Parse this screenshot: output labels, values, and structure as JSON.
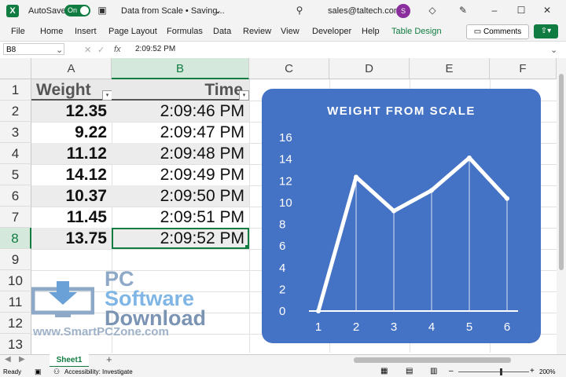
{
  "titlebar": {
    "autosave_label": "AutoSave",
    "autosave_state": "On",
    "doc_title": "Data from Scale • Saving...",
    "account": "sales@taltech.com",
    "avatar_initial": "S"
  },
  "ribbon": {
    "tabs": [
      "File",
      "Home",
      "Insert",
      "Page Layout",
      "Formulas",
      "Data",
      "Review",
      "View",
      "Developer",
      "Help",
      "Table Design"
    ],
    "comments_label": "Comments"
  },
  "formula_bar": {
    "name_box": "B8",
    "fx_label": "fx",
    "value": "2:09:52 PM"
  },
  "grid": {
    "columns": [
      "A",
      "B",
      "C",
      "D",
      "E",
      "F"
    ],
    "rows": [
      "1",
      "2",
      "3",
      "4",
      "5",
      "6",
      "7",
      "8",
      "9",
      "10",
      "11",
      "12",
      "13"
    ],
    "table": {
      "headers": [
        "Weight",
        "Time"
      ],
      "rows": [
        [
          "12.35",
          "2:09:46 PM"
        ],
        [
          "9.22",
          "2:09:47 PM"
        ],
        [
          "11.12",
          "2:09:48 PM"
        ],
        [
          "14.12",
          "2:09:49 PM"
        ],
        [
          "10.37",
          "2:09:50 PM"
        ],
        [
          "11.45",
          "2:09:51 PM"
        ],
        [
          "13.75",
          "2:09:52 PM"
        ]
      ]
    }
  },
  "watermark": {
    "line1": "PC",
    "line2": "Software",
    "line3": "Download",
    "url": "www.SmartPCZone.com"
  },
  "chart_data": {
    "type": "line",
    "title": "WEIGHT FROM SCALE",
    "x": [
      1,
      2,
      3,
      4,
      5,
      6
    ],
    "series": [
      {
        "values": [
          0,
          12.35,
          9.22,
          11.12,
          14.12,
          10.37
        ]
      }
    ],
    "ylim": [
      0,
      16
    ],
    "yticks": [
      0,
      2,
      4,
      6,
      8,
      10,
      12,
      14,
      16
    ],
    "xticks": [
      "1",
      "2",
      "3",
      "4",
      "5",
      "6"
    ],
    "grid": false,
    "legend": "none",
    "background": "#4472c4",
    "line_color": "#ffffff"
  },
  "sheets": {
    "tabs": [
      "Sheet1"
    ],
    "add_label": "+"
  },
  "status": {
    "ready": "Ready",
    "accessibility": "Accessibility: Investigate",
    "zoom": "200%"
  },
  "colors": {
    "excel_green": "#107c41",
    "chart_blue": "#4472c4"
  }
}
